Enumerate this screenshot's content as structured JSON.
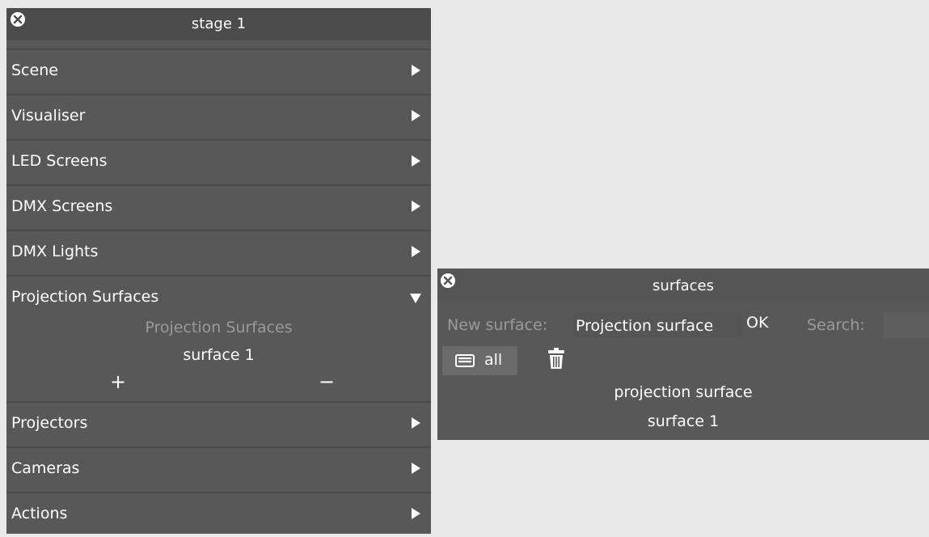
{
  "stage_panel": {
    "title": "stage 1",
    "sections": [
      {
        "label": "Scene",
        "expanded": false
      },
      {
        "label": "Visualiser",
        "expanded": false
      },
      {
        "label": "LED Screens",
        "expanded": false
      },
      {
        "label": "DMX Screens",
        "expanded": false
      },
      {
        "label": "DMX Lights",
        "expanded": false
      },
      {
        "label": "Projection Surfaces",
        "expanded": true
      },
      {
        "label": "Projectors",
        "expanded": false
      },
      {
        "label": "Cameras",
        "expanded": false
      },
      {
        "label": "Actions",
        "expanded": false
      }
    ],
    "projection_surfaces": {
      "header": "Projection Surfaces",
      "items": [
        "surface 1"
      ],
      "add_label": "+",
      "remove_label": "−"
    }
  },
  "surfaces_panel": {
    "title": "surfaces",
    "new_surface_label": "New surface:",
    "new_surface_value": "Projection surface",
    "ok_label": "OK",
    "search_label": "Search:",
    "search_value": "",
    "filter_all_label": "all",
    "list_header": "projection surface",
    "items": [
      "surface 1"
    ]
  },
  "icons": {
    "close": "close-icon",
    "arrow_right": "arrow-right-icon",
    "arrow_down": "arrow-down-icon",
    "trash": "trash-icon",
    "filter": "filter-list-icon"
  },
  "colors": {
    "panel_bg": "#585858",
    "titlebar_bg": "#4b4b4b",
    "text": "#ffffff",
    "muted_text": "#9a9a9a",
    "page_bg": "#e8e9e8"
  }
}
